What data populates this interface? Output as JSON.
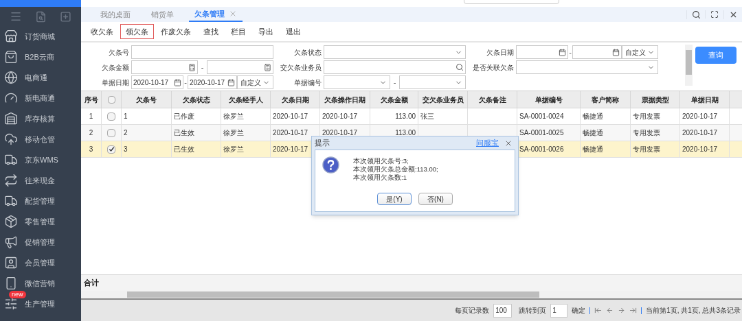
{
  "sidebar": {
    "items": [
      {
        "label": "订货商城"
      },
      {
        "label": "B2B云商"
      },
      {
        "label": "电商通"
      },
      {
        "label": "新电商通"
      },
      {
        "label": "库存核算"
      },
      {
        "label": "移动仓管"
      },
      {
        "label": "京东WMS"
      },
      {
        "label": "往来现金"
      },
      {
        "label": "配货管理"
      },
      {
        "label": "零售管理"
      },
      {
        "label": "促销管理"
      },
      {
        "label": "会员管理"
      },
      {
        "label": "微信营销"
      },
      {
        "label": "生产管理",
        "badge": "new"
      }
    ]
  },
  "tabs": [
    {
      "label": "我的桌面",
      "selected": false,
      "closable": false
    },
    {
      "label": "销货单",
      "selected": false,
      "closable": false
    },
    {
      "label": "欠条管理",
      "selected": true,
      "closable": true
    }
  ],
  "toolbar": [
    {
      "label": "收欠条",
      "selected": false
    },
    {
      "label": "领欠条",
      "selected": true
    },
    {
      "label": "作废欠条",
      "selected": false
    },
    {
      "label": "查找",
      "selected": false
    },
    {
      "label": "栏目",
      "selected": false
    },
    {
      "label": "导出",
      "selected": false
    },
    {
      "label": "退出",
      "selected": false
    }
  ],
  "filters": [
    {
      "label": "欠条号",
      "kind": "text"
    },
    {
      "label": "欠条状态",
      "kind": "select"
    },
    {
      "label": "欠条日期",
      "kind": "date-range",
      "separator": "-",
      "preset": "自定义"
    },
    {
      "label": "欠条金额",
      "kind": "number-range",
      "separator": "-"
    },
    {
      "label": "交欠条业务员",
      "kind": "lookup"
    },
    {
      "label": "是否关联欠条",
      "kind": "select"
    },
    {
      "label": "单据日期",
      "kind": "date-range",
      "separator": "-",
      "from": "2020-10-17",
      "to": "2020-10-17",
      "preset": "自定义"
    },
    {
      "label": "单据编号",
      "kind": "select-range",
      "separator": "-"
    }
  ],
  "query_button": "查询",
  "table": {
    "columns": [
      "序号",
      "欠条号",
      "欠条状态",
      "欠条经手人",
      "欠条日期",
      "欠条操作日期",
      "欠条金额",
      "交欠条业务员",
      "欠条备注",
      "单据编号",
      "客户简称",
      "票据类型",
      "单据日期"
    ],
    "all_checked": false,
    "rows": [
      {
        "selected": false,
        "checked": false,
        "cells": [
          "1",
          "1",
          "已作废",
          "徐罗兰",
          "2020-10-17",
          "2020-10-17",
          "113.00",
          "张三",
          null,
          "SA-0001-0024",
          "畅捷通",
          "专用发票",
          "2020-10-17"
        ]
      },
      {
        "selected": false,
        "checked": false,
        "cells": [
          "2",
          "2",
          "已生效",
          "徐罗兰",
          "2020-10-17",
          "2020-10-17",
          "113.00",
          null,
          null,
          "SA-0001-0025",
          "畅捷通",
          "专用发票",
          "2020-10-17"
        ]
      },
      {
        "selected": true,
        "checked": true,
        "cells": [
          "3",
          "3",
          "已生效",
          "徐罗兰",
          "2020-10-17",
          null,
          null,
          null,
          null,
          "SA-0001-0026",
          "畅捷通",
          "专用发票",
          "2020-10-17"
        ]
      }
    ],
    "total_label": "合计"
  },
  "pager": {
    "page_size_label": "每页记录数",
    "page_size": "100",
    "goto_label": "跳转到页",
    "goto_page": "1",
    "confirm": "确定",
    "summary": "当前第1页, 共1页, 总共3条记录"
  },
  "dialog": {
    "title": "提示",
    "link": "问服宝",
    "lines": [
      "本次领用欠条号:3;",
      "本次领用欠条总金额:113.00;",
      "本次领用欠条数:1"
    ],
    "buttons": [
      {
        "label": "是(Y)",
        "selected": true
      },
      {
        "label": "否(N)",
        "selected": false
      }
    ]
  }
}
